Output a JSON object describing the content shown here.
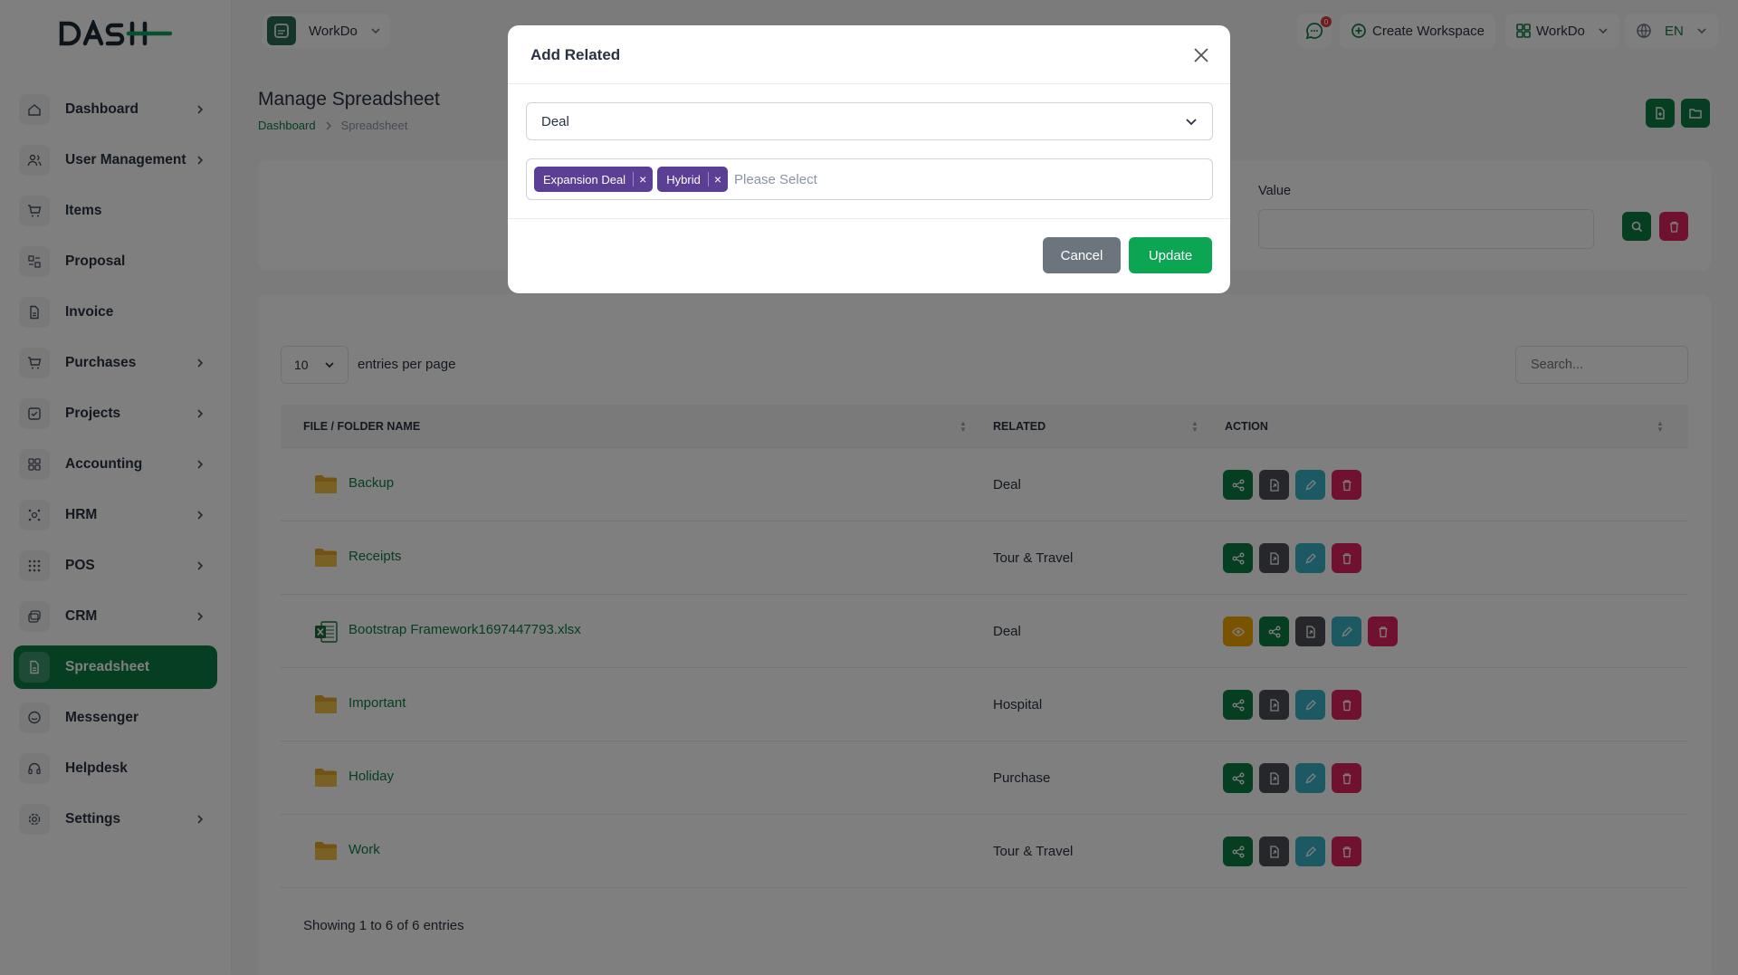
{
  "app": {
    "logo_text": "DASH",
    "workspace": "WorkDo",
    "notification_count": "0",
    "create_workspace": "Create Workspace",
    "workspace_menu": "WorkDo",
    "language": "EN"
  },
  "sidebar": {
    "items": [
      {
        "label": "Dashboard",
        "icon": "home-icon",
        "has_children": true
      },
      {
        "label": "User Management",
        "icon": "users-icon",
        "has_children": true
      },
      {
        "label": "Items",
        "icon": "cart-icon",
        "has_children": false
      },
      {
        "label": "Proposal",
        "icon": "proposal-icon",
        "has_children": false
      },
      {
        "label": "Invoice",
        "icon": "file-icon",
        "has_children": false
      },
      {
        "label": "Purchases",
        "icon": "cart-icon",
        "has_children": true
      },
      {
        "label": "Projects",
        "icon": "check-square-icon",
        "has_children": true
      },
      {
        "label": "Accounting",
        "icon": "grid-icon",
        "has_children": true
      },
      {
        "label": "HRM",
        "icon": "hrm-icon",
        "has_children": true
      },
      {
        "label": "POS",
        "icon": "dots-grid-icon",
        "has_children": true
      },
      {
        "label": "CRM",
        "icon": "layers-icon",
        "has_children": true
      },
      {
        "label": "Spreadsheet",
        "icon": "file-icon",
        "has_children": false,
        "active": true
      },
      {
        "label": "Messenger",
        "icon": "message-icon",
        "has_children": false
      },
      {
        "label": "Helpdesk",
        "icon": "headset-icon",
        "has_children": false
      },
      {
        "label": "Settings",
        "icon": "gear-icon",
        "has_children": true
      }
    ]
  },
  "page": {
    "title": "Manage Spreadsheet",
    "breadcrumb": [
      "Dashboard",
      "Spreadsheet"
    ]
  },
  "filter": {
    "value_label": "Value"
  },
  "table": {
    "entries_value": "10",
    "entries_label": "entries per page",
    "search_placeholder": "Search...",
    "columns": [
      "FILE / FOLDER NAME",
      "RELATED",
      "ACTION"
    ],
    "rows": [
      {
        "name": "Backup",
        "type": "folder",
        "related": "Deal"
      },
      {
        "name": "Receipts",
        "type": "folder",
        "related": "Tour & Travel"
      },
      {
        "name": "Bootstrap Framework1697447793.xlsx",
        "type": "excel",
        "related": "Deal"
      },
      {
        "name": "Important",
        "type": "folder",
        "related": "Hospital"
      },
      {
        "name": "Holiday",
        "type": "folder",
        "related": "Purchase"
      },
      {
        "name": "Work",
        "type": "folder",
        "related": "Tour & Travel"
      }
    ],
    "showing": "Showing 1 to 6 of 6 entries"
  },
  "modal": {
    "title": "Add Related",
    "type_value": "Deal",
    "tags": [
      "Expansion Deal",
      "Hybrid"
    ],
    "placeholder": "Please Select",
    "cancel": "Cancel",
    "update": "Update"
  },
  "colors": {
    "primary": "#0d7c45",
    "tag": "#5b3f94",
    "update": "#0ca554",
    "cancel": "#6c757d"
  }
}
